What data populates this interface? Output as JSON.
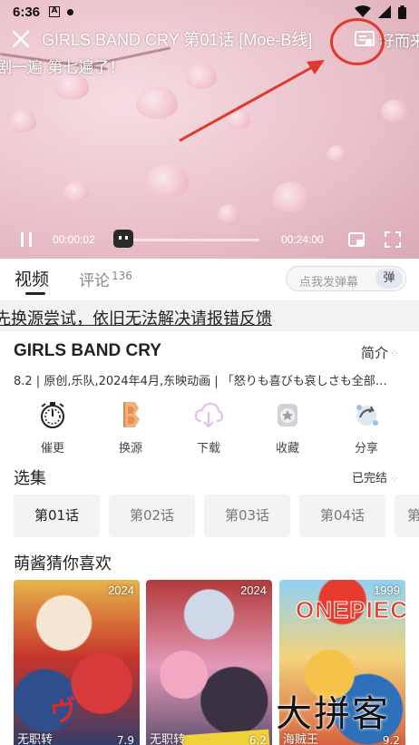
{
  "status_bar": {
    "time": "6:36",
    "icon_a": "A"
  },
  "player": {
    "title": "GIRLS BAND CRY 第01话 [Moe-B线]",
    "danmaku_top": "剧一遍 第七遍了！",
    "danmaku_right": "籽而来",
    "current_time": "00:00:02",
    "total_time": "00:24:00",
    "progress": 0.0014
  },
  "tabs": {
    "video": "视频",
    "comments": "评论",
    "comments_count": "136"
  },
  "danmaku_input": {
    "placeholder": "点我发弹幕",
    "badge": "弹"
  },
  "notice": "先换源尝试，依旧无法解决请报错反馈",
  "anime": {
    "title": "GIRLS BAND CRY",
    "intro_label": "简介",
    "meta": "8.2 | 原创,乐队,2024年4月,东映动画 | 「怒りも喜びも哀しさも全部…"
  },
  "actions": [
    {
      "label": "催更",
      "icon": "stopwatch-icon"
    },
    {
      "label": "换源",
      "icon": "source-icon"
    },
    {
      "label": "下载",
      "icon": "cloud-download-icon"
    },
    {
      "label": "收藏",
      "icon": "favorite-icon"
    },
    {
      "label": "分享",
      "icon": "share-icon"
    }
  ],
  "episodes": {
    "title": "选集",
    "status": "已完结",
    "items": [
      "第01话",
      "第02话",
      "第03话",
      "第04话",
      "第"
    ]
  },
  "recommendations": {
    "title": "萌酱猜你喜欢",
    "items": [
      {
        "year": "2024",
        "caption": "无职转",
        "score": "7.9"
      },
      {
        "year": "2024",
        "caption": "无职转",
        "score": "6.2"
      },
      {
        "year": "1999",
        "caption": "海贼王",
        "score": "9.2"
      }
    ]
  },
  "watermark": "大拼客",
  "colors": {
    "accent": "#fb7299",
    "annotation": "#e0392b",
    "badge_bg": "#e3e7ef"
  }
}
